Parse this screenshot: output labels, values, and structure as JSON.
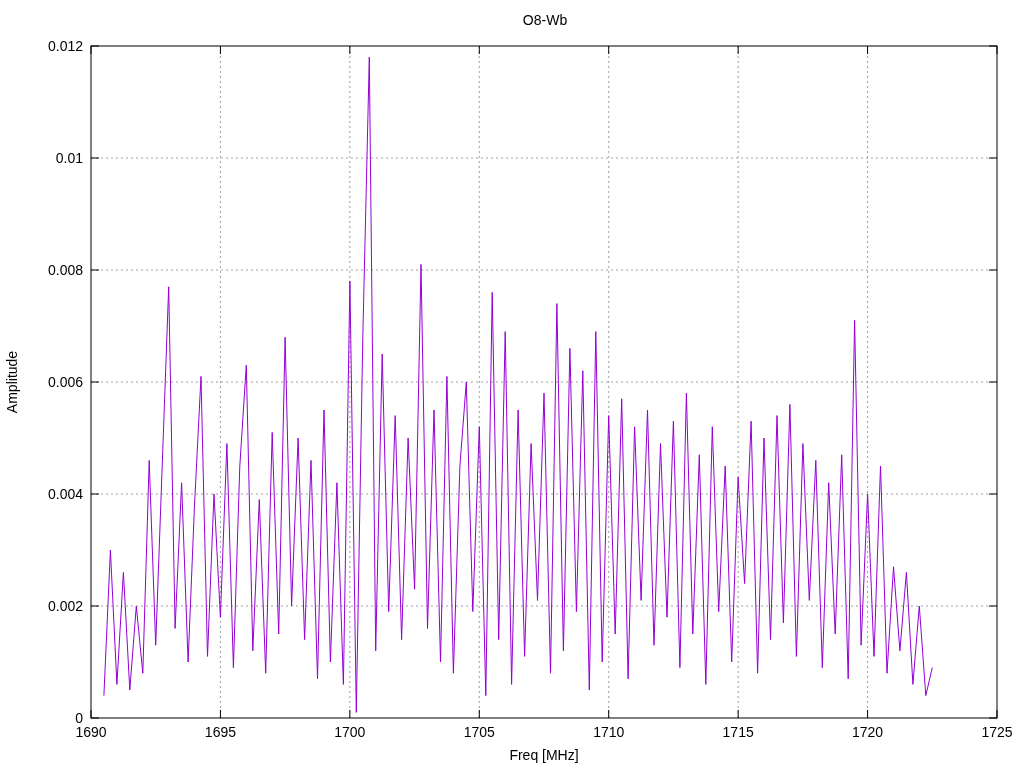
{
  "chart_data": {
    "type": "line",
    "title": "O8-Wb",
    "xlabel": "Freq [MHz]",
    "ylabel": "Amplitude",
    "xlim": [
      1690,
      1725
    ],
    "ylim": [
      0,
      0.012
    ],
    "xticks": [
      1690,
      1695,
      1700,
      1705,
      1710,
      1715,
      1720,
      1725
    ],
    "yticks": [
      0,
      0.002,
      0.004,
      0.006,
      0.008,
      0.01,
      0.012
    ],
    "grid": true,
    "x": [
      1690.5,
      1690.75,
      1691,
      1691.25,
      1691.5,
      1691.75,
      1692,
      1692.25,
      1692.5,
      1692.75,
      1693,
      1693.25,
      1693.5,
      1693.75,
      1694,
      1694.25,
      1694.5,
      1694.75,
      1695,
      1695.25,
      1695.5,
      1695.75,
      1696,
      1696.25,
      1696.5,
      1696.75,
      1697,
      1697.25,
      1697.5,
      1697.75,
      1698,
      1698.25,
      1698.5,
      1698.75,
      1699,
      1699.25,
      1699.5,
      1699.75,
      1700,
      1700.25,
      1700.5,
      1700.75,
      1701,
      1701.25,
      1701.5,
      1701.75,
      1702,
      1702.25,
      1702.5,
      1702.75,
      1703,
      1703.25,
      1703.5,
      1703.75,
      1704,
      1704.25,
      1704.5,
      1704.75,
      1705,
      1705.25,
      1705.5,
      1705.75,
      1706,
      1706.25,
      1706.5,
      1706.75,
      1707,
      1707.25,
      1707.5,
      1707.75,
      1708,
      1708.25,
      1708.5,
      1708.75,
      1709,
      1709.25,
      1709.5,
      1709.75,
      1710,
      1710.25,
      1710.5,
      1710.75,
      1711,
      1711.25,
      1711.5,
      1711.75,
      1712,
      1712.25,
      1712.5,
      1712.75,
      1713,
      1713.25,
      1713.5,
      1713.75,
      1714,
      1714.25,
      1714.5,
      1714.75,
      1715,
      1715.25,
      1715.5,
      1715.75,
      1716,
      1716.25,
      1716.5,
      1716.75,
      1717,
      1717.25,
      1717.5,
      1717.75,
      1718,
      1718.25,
      1718.5,
      1718.75,
      1719,
      1719.25,
      1719.5,
      1719.75,
      1720,
      1720.25,
      1720.5,
      1720.75,
      1721,
      1721.25,
      1721.5,
      1721.75,
      1722,
      1722.25,
      1722.5
    ],
    "series": [
      {
        "color": "#9400d3",
        "values": [
          0.0004,
          0.003,
          0.0006,
          0.0026,
          0.0005,
          0.002,
          0.0008,
          0.0046,
          0.0013,
          0.0045,
          0.0077,
          0.0016,
          0.0042,
          0.001,
          0.0038,
          0.0061,
          0.0011,
          0.004,
          0.0018,
          0.0049,
          0.0009,
          0.0045,
          0.0063,
          0.0012,
          0.0039,
          0.0008,
          0.0051,
          0.0015,
          0.0068,
          0.002,
          0.005,
          0.0014,
          0.0046,
          0.0007,
          0.0055,
          0.001,
          0.0042,
          0.0006,
          0.0078,
          0.0001,
          0.0068,
          0.0118,
          0.0012,
          0.0065,
          0.0019,
          0.0054,
          0.0014,
          0.005,
          0.0023,
          0.0081,
          0.0016,
          0.0055,
          0.001,
          0.0061,
          0.0008,
          0.0045,
          0.006,
          0.0019,
          0.0052,
          0.0004,
          0.0076,
          0.0014,
          0.0069,
          0.0006,
          0.0055,
          0.0011,
          0.0049,
          0.0021,
          0.0058,
          0.0008,
          0.0074,
          0.0012,
          0.0066,
          0.0019,
          0.0062,
          0.0005,
          0.0069,
          0.001,
          0.0054,
          0.0015,
          0.0057,
          0.0007,
          0.0052,
          0.0021,
          0.0055,
          0.0013,
          0.0049,
          0.0018,
          0.0053,
          0.0009,
          0.0058,
          0.0015,
          0.0047,
          0.0006,
          0.0052,
          0.0019,
          0.0045,
          0.001,
          0.0043,
          0.0024,
          0.0053,
          0.0008,
          0.005,
          0.0014,
          0.0054,
          0.0017,
          0.0056,
          0.0011,
          0.0049,
          0.0021,
          0.0046,
          0.0009,
          0.0042,
          0.0015,
          0.0047,
          0.0007,
          0.0071,
          0.0013,
          0.004,
          0.0011,
          0.0045,
          0.0008,
          0.0027,
          0.0012,
          0.0026,
          0.0006,
          0.002,
          0.0004,
          0.0009
        ]
      }
    ]
  }
}
